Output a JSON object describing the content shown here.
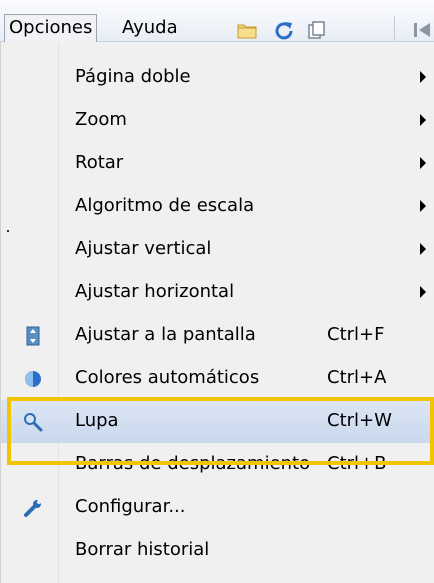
{
  "menubar": {
    "tabs": [
      {
        "label": "Opciones"
      },
      {
        "label": "Ayuda"
      }
    ],
    "toolbar_icons": [
      "folder-icon",
      "refresh-icon",
      "copy-icon",
      "first-page-icon"
    ]
  },
  "dropdown": {
    "items": [
      {
        "label": "Página doble",
        "submenu": true
      },
      {
        "label": "Zoom",
        "submenu": true
      },
      {
        "label": "Rotar",
        "submenu": true
      },
      {
        "label": "Algoritmo de escala",
        "submenu": true
      },
      {
        "label": "Ajustar vertical",
        "submenu": true
      },
      {
        "label": "Ajustar horizontal",
        "submenu": true
      },
      {
        "label": "Ajustar a la pantalla",
        "shortcut": "Ctrl+F",
        "icon": "fit-screen-icon"
      },
      {
        "label": "Colores automáticos",
        "shortcut": "Ctrl+A",
        "icon": "auto-colors-icon"
      },
      {
        "label": "Lupa",
        "shortcut": "Ctrl+W",
        "icon": "magnifier-icon",
        "highlighted": true
      },
      {
        "label": "Barras de desplazamiento",
        "shortcut": "Ctrl+B"
      },
      {
        "label": "Configurar...",
        "icon": "wrench-icon"
      },
      {
        "label": "Borrar historial"
      }
    ]
  },
  "colors": {
    "highlight_border": "#f3c400",
    "hover_background": "#c9d8ee"
  }
}
